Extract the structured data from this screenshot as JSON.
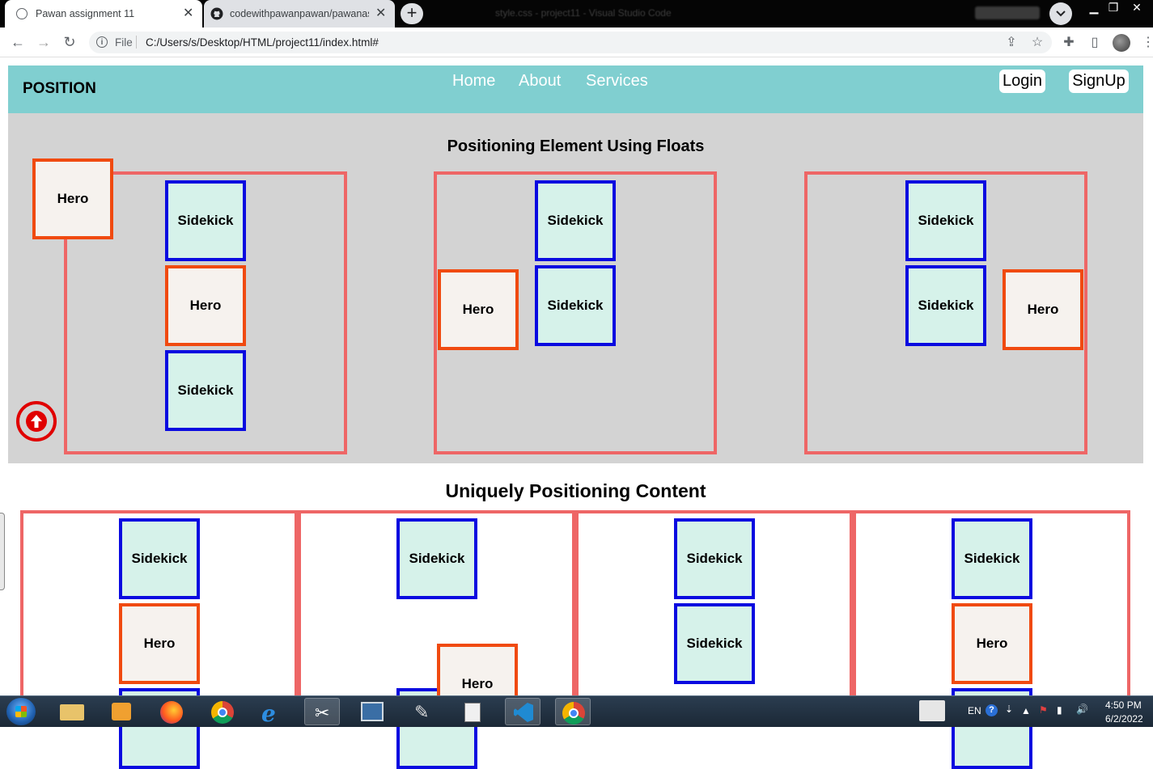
{
  "browser": {
    "tabs": [
      {
        "title": "Pawan assignment 11",
        "active": true
      },
      {
        "title": "codewithpawanpawan/pawanass",
        "active": false
      }
    ],
    "window_title": "style.css - project11 - Visual Studio Code",
    "address": {
      "scheme_label": "File",
      "url": "C:/Users/s/Desktop/HTML/project11/index.html#"
    }
  },
  "navbar": {
    "brand": "POSITION",
    "links": [
      "Home",
      "About",
      "Services"
    ],
    "auth": {
      "login": "Login",
      "signup": "SignUp"
    },
    "color": "#80cfd0"
  },
  "float_section": {
    "title": "Positioning Element Using Floats",
    "hero_label": "Hero",
    "sidekick_label": "Sidekick"
  },
  "unique_section": {
    "title": "Uniquely Positioning Content"
  },
  "colors": {
    "container_border": "#ee6666",
    "sidekick_border": "#0a0ae0",
    "sidekick_fill": "#d6f2ea",
    "hero_border": "#f04a10",
    "hero_fill": "#f6f2ee",
    "section_bg": "#d3d3d3",
    "scroll_top_icon": "#e00000"
  },
  "taskbar": {
    "language": "EN",
    "time": "4:50 PM",
    "date": "6/2/2022"
  }
}
